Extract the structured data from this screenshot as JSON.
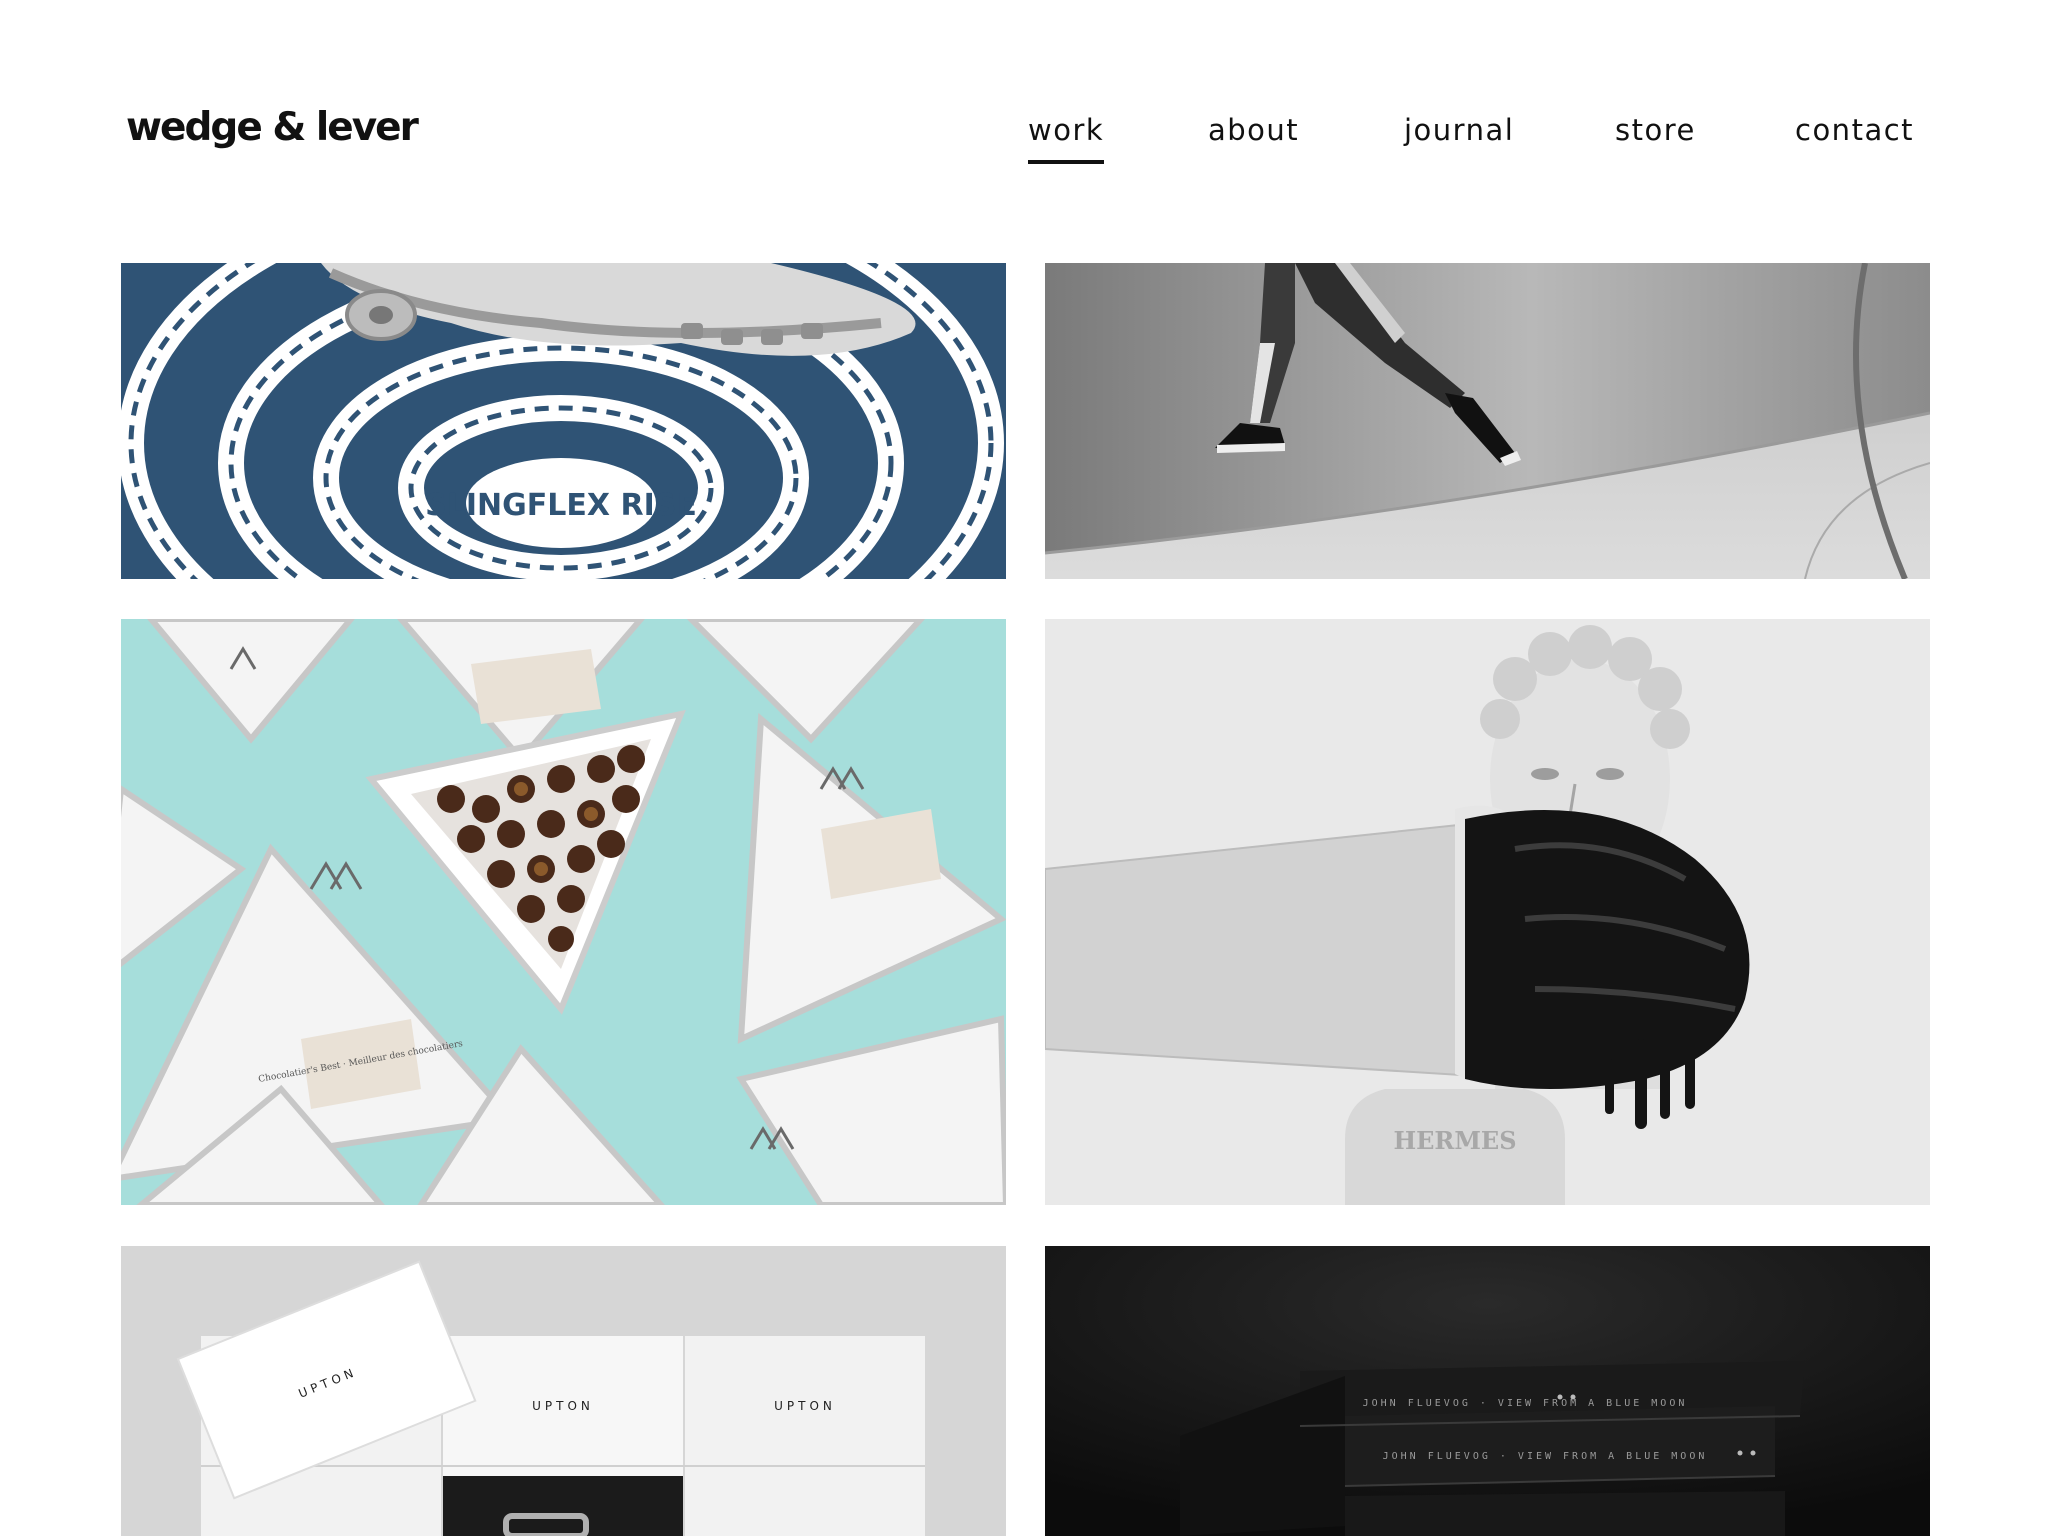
{
  "brand": {
    "logo_text": "wedge & lever"
  },
  "nav": {
    "items": [
      {
        "label": "work",
        "active": true
      },
      {
        "label": "about",
        "active": false
      },
      {
        "label": "journal",
        "active": false
      },
      {
        "label": "store",
        "active": false
      },
      {
        "label": "contact",
        "active": false
      }
    ]
  },
  "projects": [
    {
      "subject": "sneaker-sole-typographic-swirl",
      "visible_text": "SLINGFLEX RISE"
    },
    {
      "subject": "runner-leaping-concrete-tunnel"
    },
    {
      "subject": "triangular-chocolate-boxes",
      "visible_text": "Chocolatier's Best · Meilleur des chocolatiers"
    },
    {
      "subject": "classical-bust-black-glove",
      "visible_text": "HERMES"
    },
    {
      "subject": "white-upton-boxes",
      "visible_text": "UPTON"
    },
    {
      "subject": "black-hardcover-books",
      "visible_text": "JOHN FLUEVOG · VIEW FROM A BLUE MOON"
    }
  ],
  "colors": {
    "text": "#111111",
    "background": "#ffffff",
    "navy": "#2f5375",
    "teal": "#a6dedb",
    "concrete": "#bdbdbd"
  }
}
